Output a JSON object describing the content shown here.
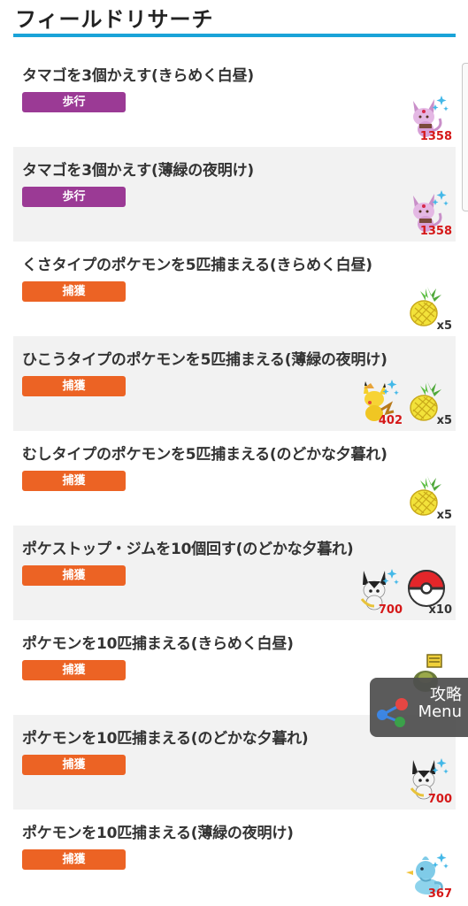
{
  "page": {
    "title": "フィールドリサーチ"
  },
  "menu_button": {
    "line1": "攻略",
    "line2": "Menu"
  },
  "colors": {
    "accent": "#1aa3d8",
    "walk_badge": "#9b3a95",
    "catch_badge": "#ec6324",
    "reward_count": "#d51818"
  },
  "tasks": [
    {
      "title": "タマゴを3個かえす(きらめく白昼)",
      "badge": "歩行",
      "rewards": [
        {
          "icon": "espeon-icon",
          "count": "1358"
        }
      ]
    },
    {
      "title": "タマゴを3個かえす(薄緑の夜明け)",
      "badge": "歩行",
      "rewards": [
        {
          "icon": "espeon-icon",
          "count": "1358"
        }
      ]
    },
    {
      "title": "くさタイプのポケモンを5匹捕まえる(きらめく白昼)",
      "badge": "捕獲",
      "rewards": [
        {
          "icon": "pinap-berry-icon",
          "count": "x5"
        }
      ]
    },
    {
      "title": "ひこうタイプのポケモンを5匹捕まえる(薄緑の夜明け)",
      "badge": "捕獲",
      "rewards": [
        {
          "icon": "pikachu-icon",
          "count": "402"
        },
        {
          "icon": "pinap-berry-icon",
          "count": "x5"
        }
      ]
    },
    {
      "title": "むしタイプのポケモンを5匹捕まえる(のどかな夕暮れ)",
      "badge": "捕獲",
      "rewards": [
        {
          "icon": "pinap-berry-icon",
          "count": "x5"
        }
      ]
    },
    {
      "title": "ポケストップ・ジムを10個回す(のどかな夕暮れ)",
      "badge": "捕獲",
      "rewards": [
        {
          "icon": "emolga-icon",
          "count": "700"
        },
        {
          "icon": "poke-ball-icon",
          "count": "x10"
        }
      ]
    },
    {
      "title": "ポケモンを10匹捕まえる(きらめく白昼)",
      "badge": "捕獲",
      "rewards": [
        {
          "icon": "pokemon-reward-icon",
          "count": ""
        }
      ]
    },
    {
      "title": "ポケモンを10匹捕まえる(のどかな夕暮れ)",
      "badge": "捕獲",
      "rewards": [
        {
          "icon": "emolga-icon",
          "count": "700"
        }
      ]
    },
    {
      "title": "ポケモンを10匹捕まえる(薄緑の夜明け)",
      "badge": "捕獲",
      "rewards": [
        {
          "icon": "ducklett-icon",
          "count": "367"
        }
      ]
    }
  ]
}
